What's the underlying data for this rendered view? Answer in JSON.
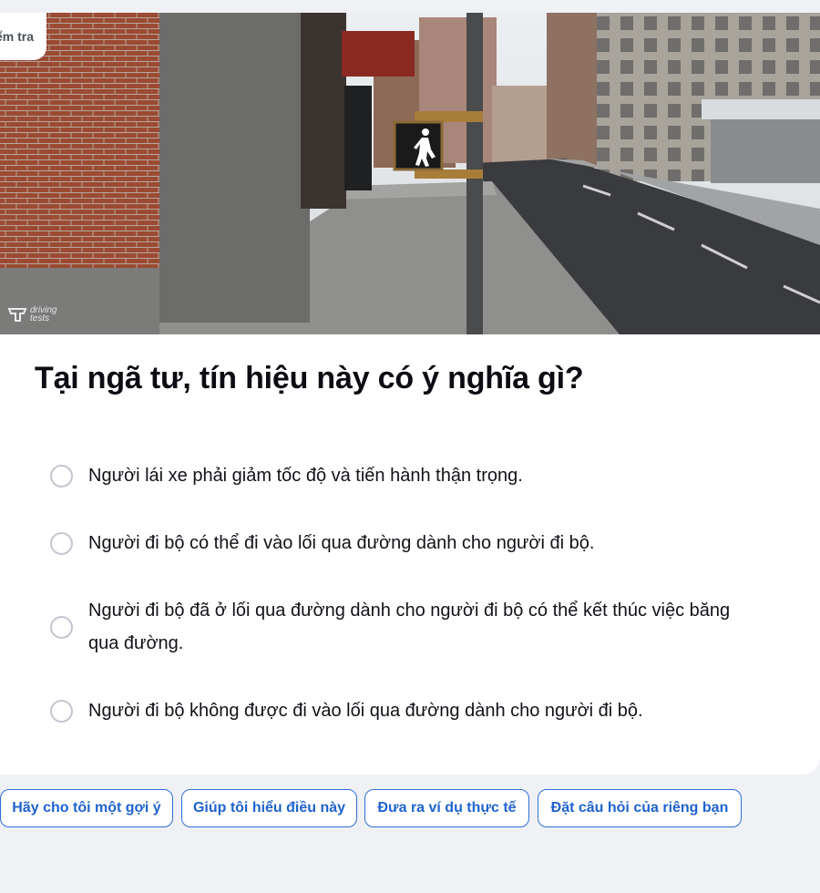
{
  "header": {
    "tag_label": "Kiểm tra"
  },
  "image": {
    "icon": "pedestrian-walk-signal-icon",
    "watermark_line1": "driving",
    "watermark_line2": "tests"
  },
  "question": {
    "text": "Tại ngã tư, tín hiệu này có ý nghĩa gì?"
  },
  "options": [
    {
      "label": "Người lái xe phải giảm tốc độ và tiến hành thận trọng.",
      "selected": false
    },
    {
      "label": "Người đi bộ có thể đi vào lối qua đường dành cho người đi bộ.",
      "selected": false
    },
    {
      "label": "Người đi bộ đã ở lối qua đường dành cho người đi bộ có thể kết thúc việc băng qua đường.",
      "selected": false
    },
    {
      "label": "Người đi bộ không được đi vào lối qua đường dành cho người đi bộ.",
      "selected": false
    }
  ],
  "suggestions": [
    "Hãy cho tôi một gợi ý",
    "Giúp tôi hiểu điều này",
    "Đưa ra ví dụ thực tế",
    "Đặt câu hỏi của riêng bạn"
  ],
  "colors": {
    "accent": "#2f6fd6",
    "background": "#eff1f5",
    "card": "#ffffff",
    "radio_border": "#c3c6ce"
  }
}
